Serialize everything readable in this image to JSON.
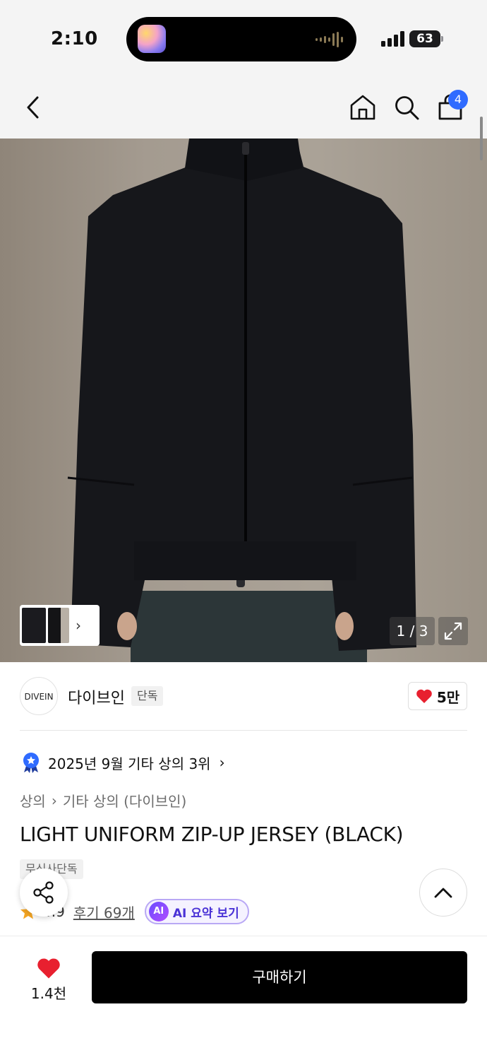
{
  "status_bar": {
    "time": "2:10",
    "battery": "63"
  },
  "nav": {
    "cart_badge": "4",
    "icons": [
      "back-icon",
      "home-icon",
      "search-icon",
      "cart-icon"
    ]
  },
  "gallery": {
    "counter": "1 / 3",
    "thumbnail_chevron": "›"
  },
  "brand": {
    "logo_text": "DIVEIN",
    "name": "다이브인",
    "tag": "단독",
    "likes": "5만"
  },
  "ranking": {
    "text": "2025년 9월 기타 상의 3위",
    "chevron": "›"
  },
  "breadcrumb": {
    "level1": "상의",
    "separator": "›",
    "level2": "기타 상의 (다이브인)"
  },
  "product": {
    "title": "LIGHT UNIFORM ZIP-UP JERSEY (BLACK)",
    "store_tag": "무신사단독",
    "rating": "4.9",
    "review_link": "후기 69개",
    "ai_badge": "AI",
    "ai_summary_label": "AI 요약 보기"
  },
  "bottom_bar": {
    "wish_count": "1.4천",
    "buy_label": "구매하기"
  },
  "colors": {
    "accent_blue": "#2f6bff",
    "heart_red": "#e8202f",
    "ai_purple": "#4a32d6",
    "buy_black": "#000000"
  }
}
